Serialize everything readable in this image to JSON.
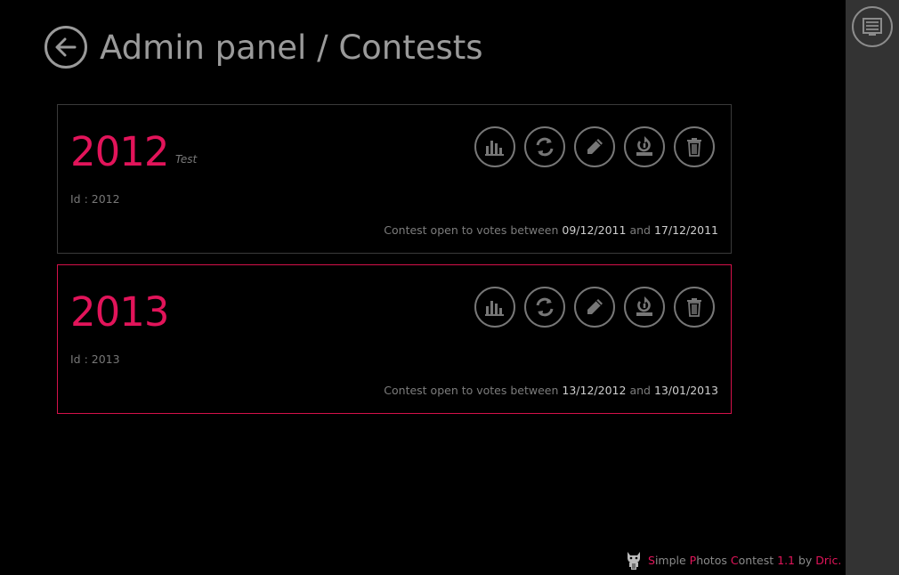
{
  "header": {
    "title": "Admin panel / Contests"
  },
  "contests": [
    {
      "title": "2012",
      "description": "Test",
      "id_label": "Id : 2012",
      "dates_prefix": "Contest open to votes between",
      "start_date": "09/12/2011",
      "dates_and": "and",
      "end_date": "17/12/2011",
      "selected": false
    },
    {
      "title": "2013",
      "description": "",
      "id_label": "Id : 2013",
      "dates_prefix": "Contest open to votes between",
      "start_date": "13/12/2012",
      "dates_and": "and",
      "end_date": "13/01/2013",
      "selected": true
    }
  ],
  "actions": [
    "bar-chart-icon",
    "refresh-icon",
    "pencil-icon",
    "reset-results-icon",
    "trash-icon"
  ],
  "footer": {
    "s": "S",
    "imple": "imple ",
    "p": "P",
    "hotos": "hotos ",
    "c": "C",
    "ontest": "ontest ",
    "version": "1.1",
    "by": " by ",
    "author": "Dric."
  },
  "colors": {
    "accent": "#e2145a",
    "background": "#000000",
    "sidebar": "#333333",
    "selected_border": "#d4114a"
  }
}
